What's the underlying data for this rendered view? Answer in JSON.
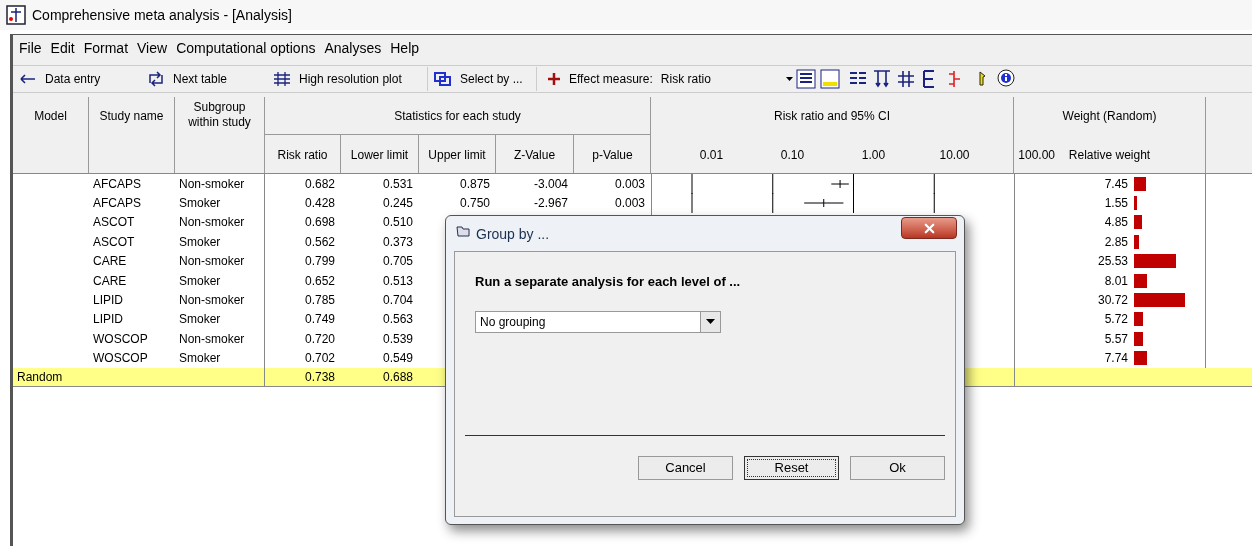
{
  "window": {
    "title": "Comprehensive meta analysis - [Analysis]"
  },
  "menu": [
    "File",
    "Edit",
    "Format",
    "View",
    "Computational options",
    "Analyses",
    "Help"
  ],
  "toolbar": {
    "buttons": [
      "Data entry",
      "Next table",
      "High resolution plot",
      "Select by ..."
    ],
    "effect_label": "Effect measure:",
    "effect_value": "Risk ratio"
  },
  "table": {
    "columns": {
      "model": "Model",
      "study": "Study name",
      "subgroup": "Subgroup within study",
      "stats_group": "Statistics for each study",
      "stats": [
        "Risk ratio",
        "Lower limit",
        "Upper limit",
        "Z-Value",
        "p-Value"
      ],
      "forest_title": "Risk ratio and 95% CI",
      "forest_ticks": [
        "0.01",
        "0.10",
        "1.00",
        "10.00",
        "100.00"
      ],
      "weight_title": "Weight (Random)",
      "weight_sub": "Relative weight"
    },
    "rows": [
      {
        "study": "AFCAPS",
        "subgroup": "Non-smoker",
        "stats": [
          "0.682",
          "0.531",
          "0.875",
          "-3.004",
          "0.003"
        ],
        "weight": "7.45"
      },
      {
        "study": "AFCAPS",
        "subgroup": "Smoker",
        "stats": [
          "0.428",
          "0.245",
          "0.750",
          "-2.967",
          "0.003"
        ],
        "weight": "1.55"
      },
      {
        "study": "ASCOT",
        "subgroup": "Non-smoker",
        "stats": [
          "0.698",
          "0.510"
        ],
        "weight": "4.85"
      },
      {
        "study": "ASCOT",
        "subgroup": "Smoker",
        "stats": [
          "0.562",
          "0.373"
        ],
        "weight": "2.85"
      },
      {
        "study": "CARE",
        "subgroup": "Non-smoker",
        "stats": [
          "0.799",
          "0.705"
        ],
        "weight": "25.53"
      },
      {
        "study": "CARE",
        "subgroup": "Smoker",
        "stats": [
          "0.652",
          "0.513"
        ],
        "weight": "8.01"
      },
      {
        "study": "LIPID",
        "subgroup": "Non-smoker",
        "stats": [
          "0.785",
          "0.704"
        ],
        "weight": "30.72"
      },
      {
        "study": "LIPID",
        "subgroup": "Smoker",
        "stats": [
          "0.749",
          "0.563"
        ],
        "weight": "5.72"
      },
      {
        "study": "WOSCOP",
        "subgroup": "Non-smoker",
        "stats": [
          "0.720",
          "0.539"
        ],
        "weight": "5.57"
      },
      {
        "study": "WOSCOP",
        "subgroup": "Smoker",
        "stats": [
          "0.702",
          "0.549"
        ],
        "weight": "7.74"
      }
    ],
    "summary": {
      "model": "Random",
      "stats": [
        "0.738",
        "0.688"
      ]
    }
  },
  "dialog": {
    "title": "Group by ...",
    "prompt": "Run a separate analysis for each level of ...",
    "select": "No grouping",
    "buttons": [
      {
        "label": "Cancel",
        "focused": false
      },
      {
        "label": "Reset",
        "focused": true
      },
      {
        "label": "Ok",
        "focused": false
      }
    ]
  }
}
